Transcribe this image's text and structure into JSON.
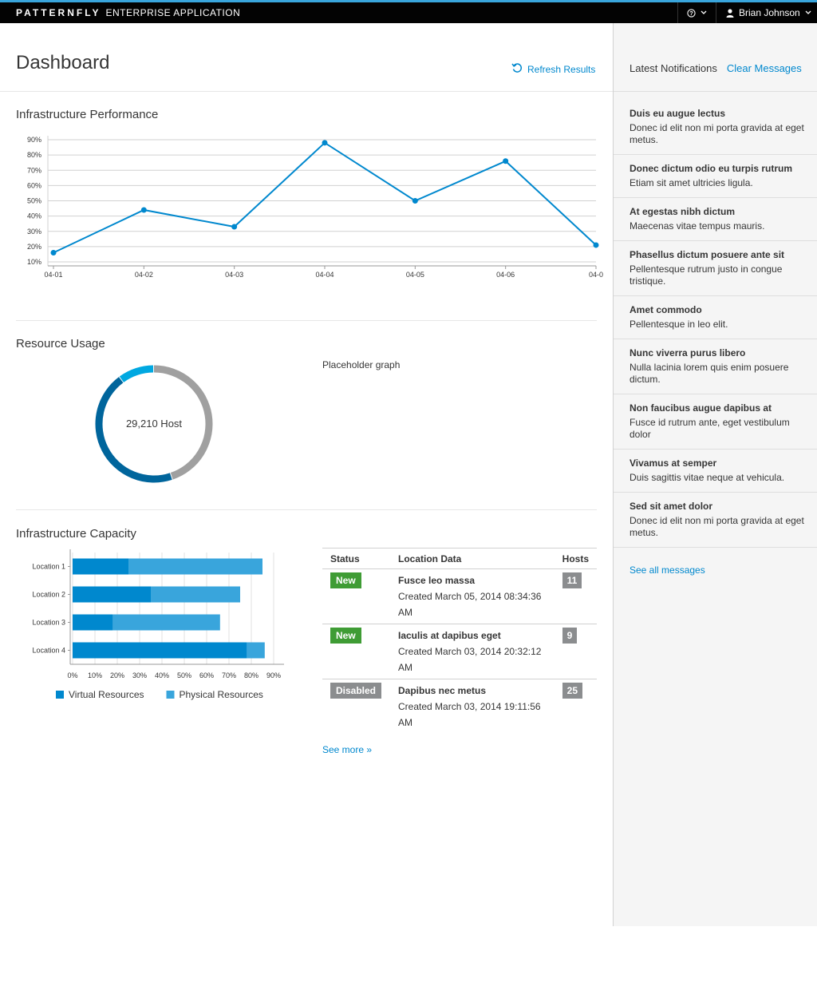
{
  "header": {
    "brand_name": "PATTERNFLY",
    "brand_sub": "ENTERPRISE APPLICATION",
    "user_name": "Brian Johnson",
    "accent_color": "#39a5dc"
  },
  "page": {
    "title": "Dashboard",
    "refresh_label": "Refresh Results"
  },
  "sections": {
    "performance": "Infrastructure Performance",
    "usage": "Resource Usage",
    "capacity": "Infrastructure Capacity"
  },
  "performance_chart": {
    "type": "line",
    "x": [
      "04-01",
      "04-02",
      "04-03",
      "04-04",
      "04-05",
      "04-06",
      "04-0"
    ],
    "values": [
      16,
      44,
      33,
      88,
      50,
      76,
      21
    ],
    "y_ticks": [
      "10%",
      "20%",
      "30%",
      "40%",
      "50%",
      "60%",
      "70%",
      "80%",
      "90%"
    ],
    "ylim": [
      10,
      90
    ],
    "color": "#0088ce"
  },
  "usage_chart": {
    "type": "pie",
    "center_label": "29,210 Host",
    "slices": [
      {
        "name": "Used (dark)",
        "value": 45,
        "color": "#00659c"
      },
      {
        "name": "Used (light)",
        "value": 10,
        "color": "#00a8e1"
      },
      {
        "name": "Available",
        "value": 45,
        "color": "#a0a0a0"
      }
    ]
  },
  "placeholder_text": "Placeholder graph",
  "chart_data": {
    "type": "bar",
    "categories": [
      "Location 1",
      "Location 2",
      "Location 3",
      "Location 4"
    ],
    "series": [
      {
        "name": "Virtual Resources",
        "values": [
          25,
          35,
          18,
          78
        ],
        "color": "#0088ce"
      },
      {
        "name": "Physical Resources",
        "values": [
          60,
          40,
          48,
          8
        ],
        "color": "#39a5dc"
      }
    ],
    "x_ticks": [
      "0%",
      "10%",
      "20%",
      "30%",
      "40%",
      "50%",
      "60%",
      "70%",
      "80%",
      "90%"
    ],
    "xlim": [
      0,
      90
    ],
    "stacked": true,
    "orientation": "horizontal",
    "legend": "bottom"
  },
  "capacity_table": {
    "headers": [
      "Status",
      "Location Data",
      "Hosts"
    ],
    "rows": [
      {
        "status": "New",
        "name": "Fusce leo massa",
        "created": "Created March 05, 2014 08:34:36 AM",
        "hosts": "11"
      },
      {
        "status": "New",
        "name": "Iaculis at dapibus eget",
        "created": "Created March 03, 2014 20:32:12 AM",
        "hosts": "9"
      },
      {
        "status": "Disabled",
        "name": "Dapibus nec metus",
        "created": "Created March 03, 2014 19:11:56 AM",
        "hosts": "25"
      }
    ],
    "see_more": "See more »"
  },
  "notifications": {
    "title": "Latest Notifications",
    "clear_label": "Clear Messages",
    "items": [
      {
        "title": "Duis eu augue lectus",
        "body": "Donec id elit non mi porta gravida at eget metus."
      },
      {
        "title": "Donec dictum odio eu turpis rutrum",
        "body": "Etiam sit amet ultricies ligula."
      },
      {
        "title": "At egestas nibh dictum",
        "body": "Maecenas vitae tempus mauris."
      },
      {
        "title": "Phasellus dictum posuere ante sit",
        "body": "Pellentesque rutrum justo in congue tristique."
      },
      {
        "title": "Amet commodo",
        "body": "Pellentesque in leo elit."
      },
      {
        "title": "Nunc viverra purus libero",
        "body": "Nulla lacinia lorem quis enim posuere dictum."
      },
      {
        "title": "Non faucibus augue dapibus at",
        "body": "Fusce id rutrum ante, eget vestibulum dolor"
      },
      {
        "title": "Vivamus at semper",
        "body": "Duis sagittis vitae neque at vehicula."
      },
      {
        "title": "Sed sit amet dolor",
        "body": "Donec id elit non mi porta gravida at eget metus."
      }
    ],
    "see_all": "See all messages"
  }
}
